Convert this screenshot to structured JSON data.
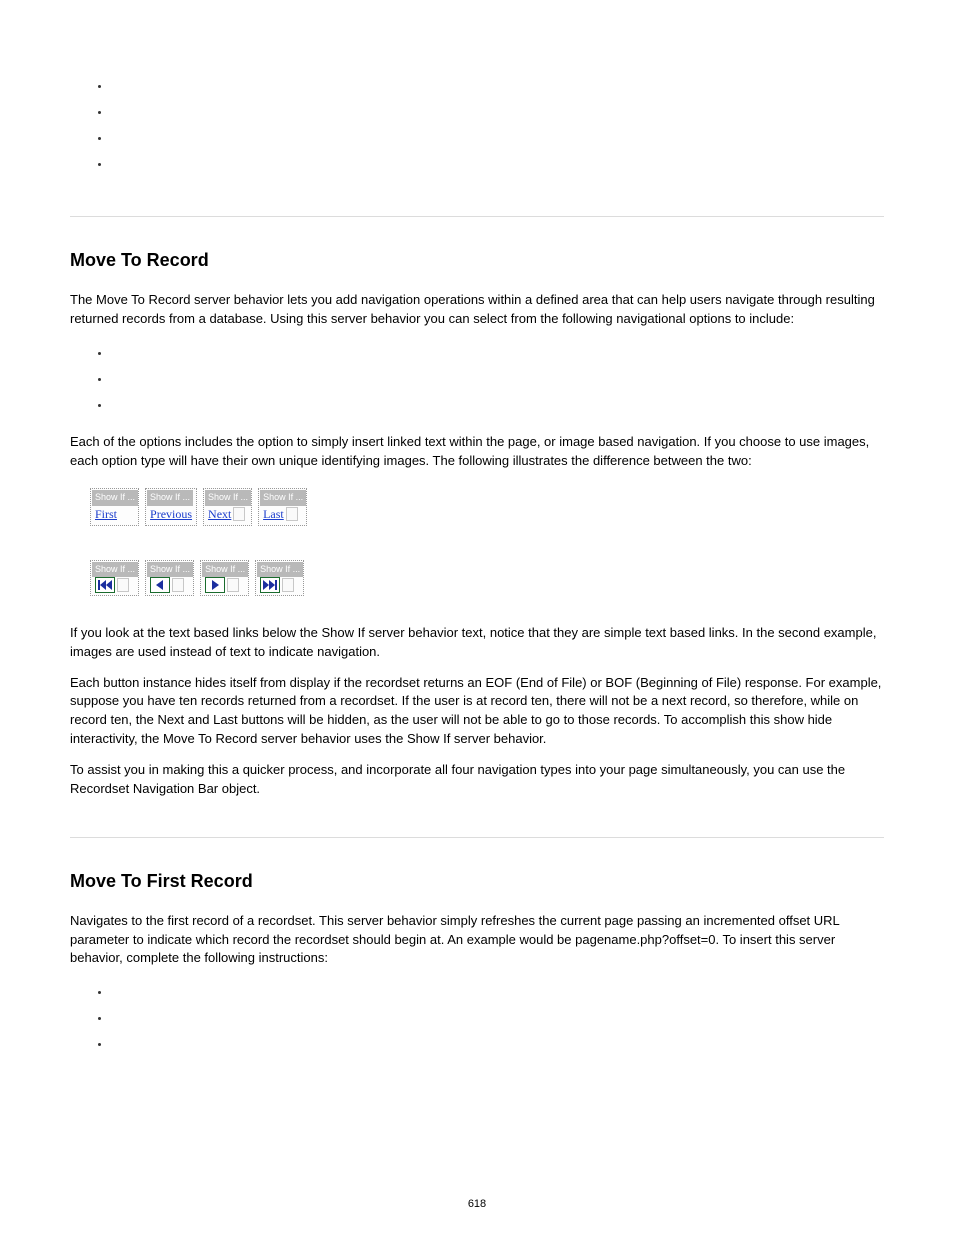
{
  "sectionA": {
    "bullets": [
      "",
      "",
      "",
      ""
    ]
  },
  "sectionB": {
    "title": "Move To Record",
    "intro_lines": [
      "The Move To Record server behavior lets you add navigation operations within a defined area that can help users navigate",
      "through resulting returned records from a database. Using this server behavior you can select from the following navigational",
      "options to include:"
    ],
    "bullets": [
      "",
      "",
      ""
    ],
    "afterBulletsText": "Each of the options includes the option to simply insert linked text within the page, or image based navigation. If you choose to use images, each option type will have their own unique identifying images. The following illustrates the difference between the two:",
    "navbar_tag": "Show If ...",
    "text_links": [
      "First",
      "Previous",
      "Next",
      "Last"
    ],
    "closing_lines": [
      "If you look at the text based links below the Show If server behavior text, notice that they are simple text based links. In the second example, images are used instead of text to indicate navigation.",
      "",
      "Each button instance hides itself from display if the recordset returns an EOF (End of File) or BOF (Beginning of File) response. For example, suppose you have ten records returned from a recordset. If the user is at record ten, there will not be a next record, so therefore, while on record ten, the Next and Last buttons will be hidden, as the user will not be able to go to those records. To accomplish this show hide interactivity, the Move To Record server behavior uses the Show If server behavior.",
      "",
      "To assist you in making this a quicker process, and incorporate all four navigation types into your page simultaneously, you can use the Recordset Navigation Bar object."
    ]
  },
  "sectionC": {
    "title": "Move To First Record",
    "intro_lines": [
      "Navigates to the first record of a recordset. This server behavior simply refreshes the current page passing an incremented offset URL parameter to indicate which record the recordset should begin at. An example would be pagename.php?offset=0. To insert this server behavior, complete the following instructions:"
    ],
    "bullets": [
      "",
      "",
      ""
    ]
  },
  "page_number": "618"
}
